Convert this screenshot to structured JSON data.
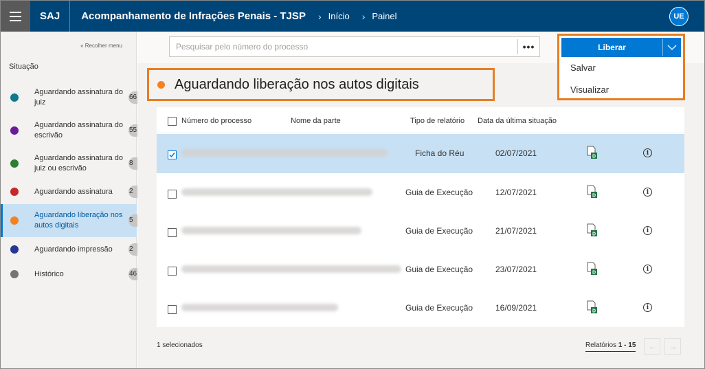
{
  "topbar": {
    "brand": "SAJ",
    "title": "Acompanhamento de Infrações Penais - TJSP",
    "breadcrumb": [
      "Início",
      "Painel"
    ],
    "avatar": "UE"
  },
  "sidebar": {
    "collapse_label": "« Recolher menu",
    "section_title": "Situação",
    "items": [
      {
        "label": "Aguardando assinatura do juiz",
        "count": "66",
        "color": "#117a8b"
      },
      {
        "label": "Aguardando assinatura do escrivão",
        "count": "55",
        "color": "#6a1b9a"
      },
      {
        "label": "Aguardando assinatura do juiz ou escrivão",
        "count": "8",
        "color": "#2e7d32"
      },
      {
        "label": "Aguardando assinatura",
        "count": "2",
        "color": "#c62828"
      },
      {
        "label": "Aguardando liberação nos autos digitais",
        "count": "5",
        "color": "#f7811f"
      },
      {
        "label": "Aguardando impressão",
        "count": "2",
        "color": "#283593"
      },
      {
        "label": "Histórico",
        "count": "46",
        "color": "#757575"
      }
    ]
  },
  "search": {
    "placeholder": "Pesquisar pelo número do processo",
    "more_label": "•••"
  },
  "heading": "Aguardando liberação nos autos digitais",
  "action": {
    "button_label": "Liberar",
    "menu": [
      "Salvar",
      "Visualizar"
    ]
  },
  "table": {
    "headers": [
      "Número do processo",
      "Nome da parte",
      "Tipo de relatório",
      "Data da última situação"
    ],
    "rows": [
      {
        "tipo": "Ficha do Réu",
        "data": "02/07/2021",
        "selected": true
      },
      {
        "tipo": "Guia de Execução",
        "data": "12/07/2021",
        "selected": false
      },
      {
        "tipo": "Guia de Execução",
        "data": "21/07/2021",
        "selected": false
      },
      {
        "tipo": "Guia de Execução",
        "data": "23/07/2021",
        "selected": false
      },
      {
        "tipo": "Guia de Execução",
        "data": "16/09/2021",
        "selected": false
      }
    ]
  },
  "footer": {
    "selected": "1 selecionados",
    "pager_prefix": "Relatórios",
    "pager_range": "1 - 15"
  },
  "colors": {
    "topbar": "#004578",
    "accent": "#0078d4",
    "highlight_border": "#e67e22",
    "excel_green": "#217346"
  }
}
